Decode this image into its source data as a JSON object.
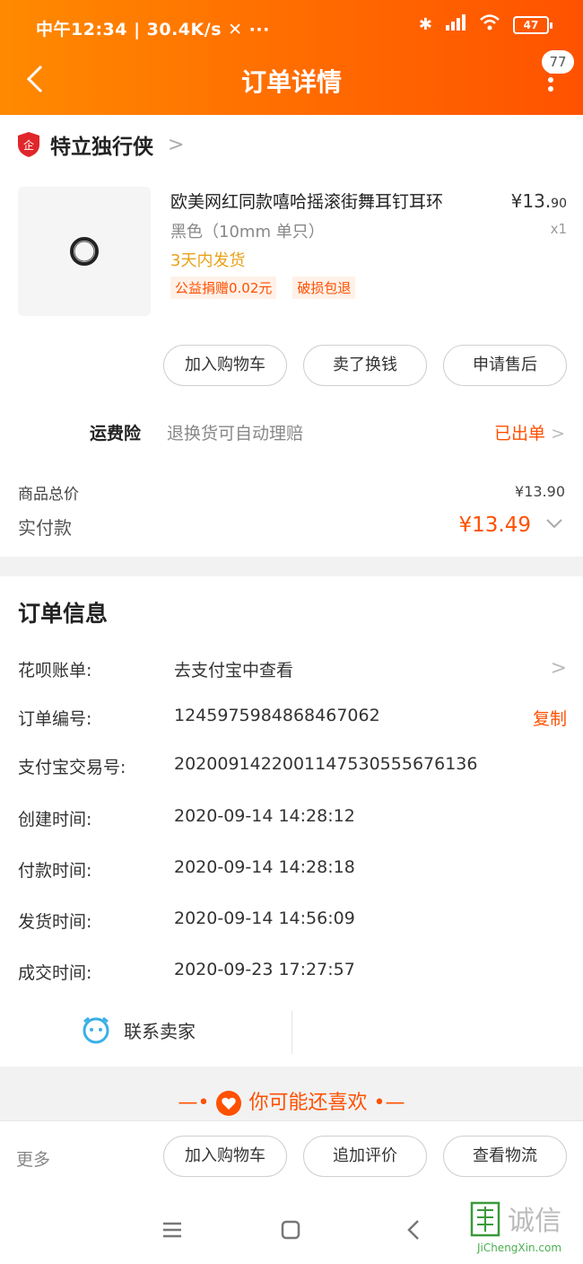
{
  "status_bar": {
    "left": "中午12:34 | 30.4K/s ✕ ···",
    "battery": "47"
  },
  "header": {
    "title": "订单详情",
    "badge": "77"
  },
  "shop": {
    "name": "特立独行侠"
  },
  "product": {
    "name": "欧美网红同款嘻哈摇滚街舞耳钉耳环",
    "price_main": "¥13.",
    "price_cents": "90",
    "sku": "黑色（10mm 单只）",
    "qty": "x1",
    "ship_note": "3天内发货",
    "tags": [
      "公益捐赠0.02元",
      "破损包退"
    ]
  },
  "order_actions": [
    "加入购物车",
    "卖了换钱",
    "申请售后"
  ],
  "insurance": {
    "label": "运费险",
    "desc": "退换货可自动理赔",
    "status": "已出单"
  },
  "totals": {
    "goods_label": "商品总价",
    "goods_value": "¥13.90",
    "paid_label": "实付款",
    "paid_main": "¥13.",
    "paid_cents": "49"
  },
  "order_info": {
    "title": "订单信息",
    "rows": [
      {
        "key": "花呗账单:",
        "value": "去支付宝中查看"
      },
      {
        "key": "订单编号:",
        "value": "1245975984868467062",
        "action": "复制"
      },
      {
        "key": "支付宝交易号:",
        "value": "2020091422001147530555676136"
      },
      {
        "key": "创建时间:",
        "value": "2020-09-14 14:28:12"
      },
      {
        "key": "付款时间:",
        "value": "2020-09-14 14:28:18"
      },
      {
        "key": "发货时间:",
        "value": "2020-09-14 14:56:09"
      },
      {
        "key": "成交时间:",
        "value": "2020-09-23 17:27:57"
      }
    ],
    "contact": "联系卖家"
  },
  "recommend": {
    "title": "你可能还喜欢"
  },
  "bottom_bar": {
    "more": "更多",
    "buttons": [
      "加入购物车",
      "追加评价",
      "查看物流"
    ]
  },
  "watermark": {
    "text": "诚信",
    "url_text": "JiChengXin.com"
  },
  "colors": {
    "accent": "#ff5000",
    "header_start": "#ff8a00",
    "header_end": "#ff5200",
    "ship_note": "#e8a21a"
  }
}
